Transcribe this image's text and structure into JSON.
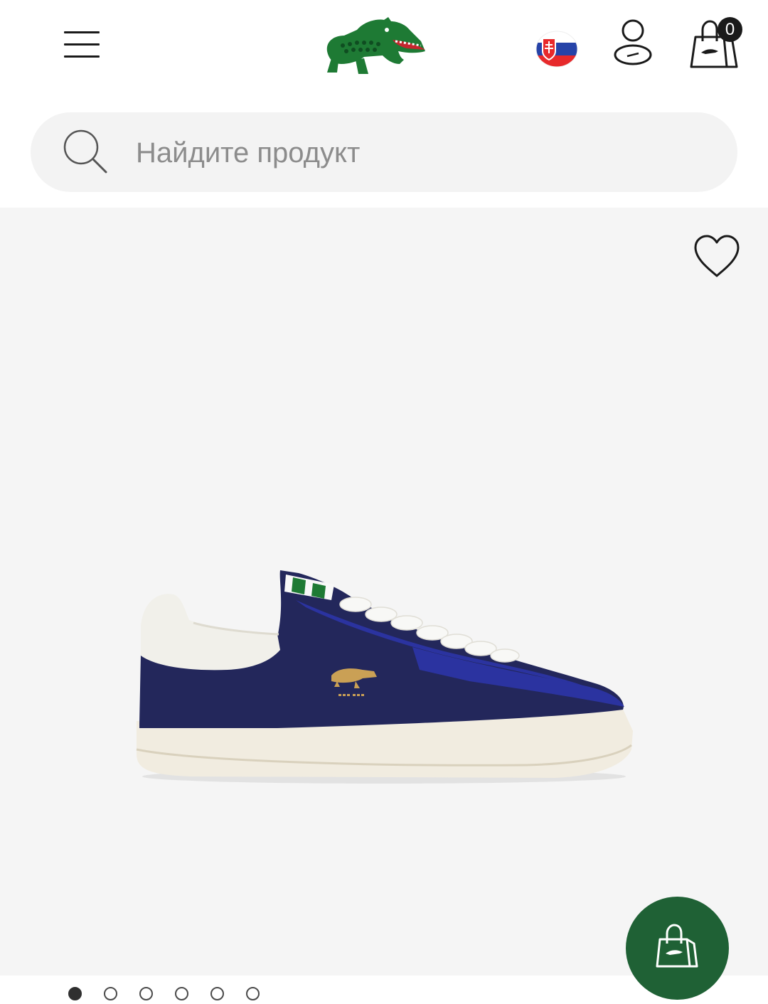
{
  "header": {
    "menu_icon": "hamburger-menu-icon",
    "logo_icon": "crocodile-logo-icon",
    "country_flag_icon": "slovakia-flag-icon",
    "account_icon": "user-account-icon",
    "cart_icon": "shopping-bag-icon",
    "cart_count": "0"
  },
  "search": {
    "icon": "search-icon",
    "placeholder": "Найдите продукт"
  },
  "gallery": {
    "wishlist_icon": "heart-icon",
    "product_image": "navy-suede-sneaker",
    "active_index": 0,
    "dots": [
      "1",
      "2",
      "3",
      "4",
      "5",
      "6"
    ]
  },
  "fab": {
    "icon": "shopping-bag-icon"
  },
  "colors": {
    "brand_green": "#1f6135",
    "logo_green": "#2e7d32",
    "gallery_bg": "#f5f5f5",
    "search_bg": "#f3f3f3",
    "shoe_navy": "#23275b",
    "shoe_royal": "#2b33a0"
  }
}
